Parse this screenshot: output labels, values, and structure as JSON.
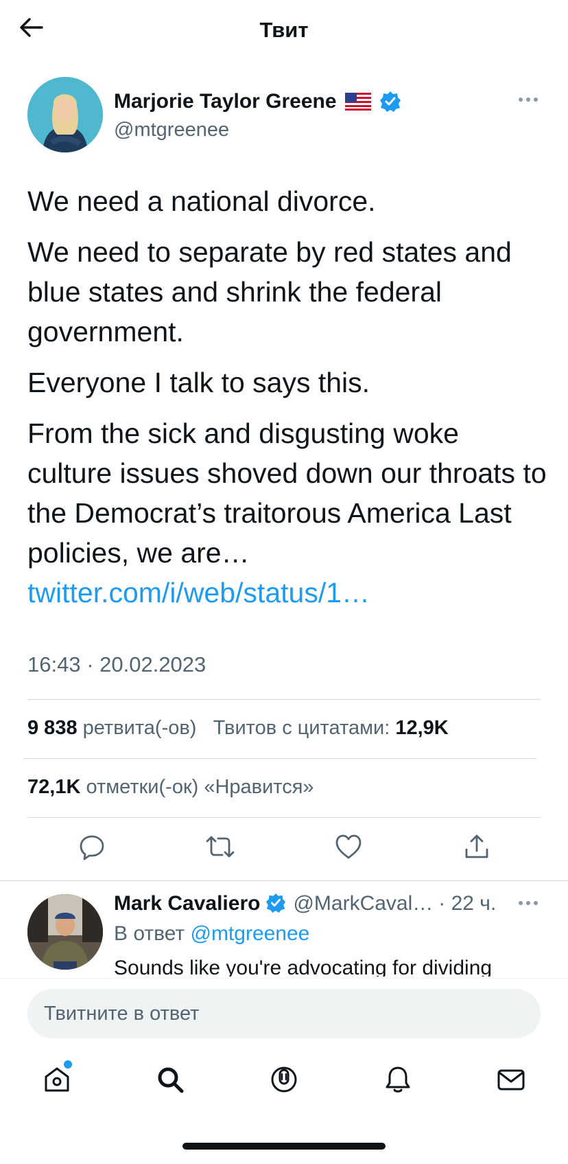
{
  "header": {
    "title": "Твит",
    "back_icon": "arrow-left-icon"
  },
  "tweet": {
    "author_name": "Marjorie Taylor Greene",
    "author_flag": "us-flag-icon",
    "handle": "@mtgreenee",
    "paragraphs": [
      "We need a national divorce.",
      "We need to separate by red states and blue states and shrink the federal government.",
      "Everyone I talk to says this.",
      "From the sick and disgusting woke culture issues shoved down our throats to the Democrat’s traitorous America Last policies, we are…"
    ],
    "link": "twitter.com/i/web/status/1…",
    "timestamp": "16:43 · 20.02.2023",
    "retweets_count": "9 838",
    "retweets_label": "ретвита(-ов)",
    "quotes_label": "Твитов с цитатами:",
    "quotes_count": "12,9K",
    "likes_count": "72,1K",
    "likes_label": "отметки(-ок) «Нравится»"
  },
  "reply": {
    "author_name": "Mark Cavaliero",
    "handle": "@MarkCaval…",
    "time": "· 22 ч.",
    "reply_to_prefix": "В ответ",
    "reply_to_handle": "@mtgreenee",
    "text": "Sounds like you're advocating for dividing"
  },
  "composer": {
    "placeholder": "Твитните в ответ"
  },
  "colors": {
    "accent": "#1d9bf0",
    "secondary_text": "#536471",
    "divider": "#cfd9de"
  },
  "nav": [
    "home-icon",
    "search-icon",
    "spaces-icon",
    "notifications-icon",
    "messages-icon"
  ]
}
